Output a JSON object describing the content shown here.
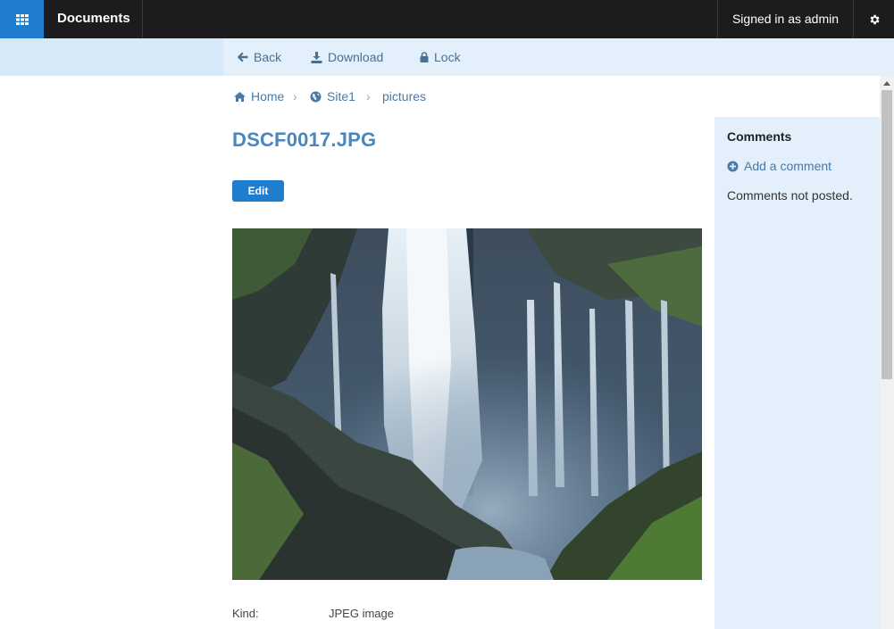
{
  "header": {
    "app_title": "Documents",
    "user_text": "Signed in as admin"
  },
  "toolbar": {
    "back_label": "Back",
    "download_label": "Download",
    "lock_label": "Lock"
  },
  "breadcrumb": {
    "items": [
      {
        "label": "Home",
        "icon": "home-icon"
      },
      {
        "label": "Site1",
        "icon": "globe-icon"
      },
      {
        "label": "pictures",
        "icon": ""
      }
    ],
    "separator": "›"
  },
  "document": {
    "title": "DSCF0017.JPG",
    "edit_label": "Edit",
    "properties": [
      {
        "label": "Kind:",
        "value": "JPEG image"
      }
    ]
  },
  "comments": {
    "title": "Comments",
    "add_label": "Add a comment",
    "status": "Comments not posted."
  },
  "colors": {
    "accent": "#1f7dcf",
    "topbar": "#1c1c1e",
    "panel": "#e3f0fb",
    "link": "#4a79a6",
    "title": "#4a86c0"
  }
}
